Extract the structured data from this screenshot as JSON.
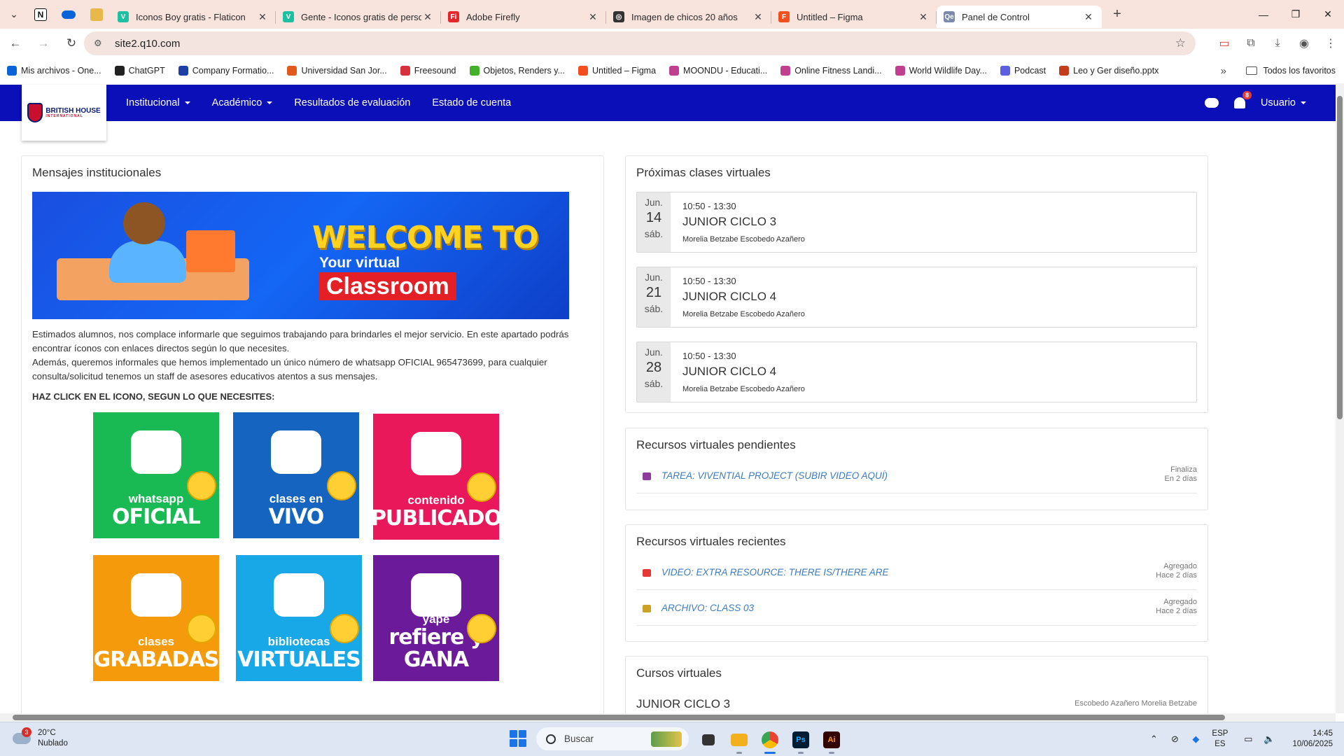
{
  "browser": {
    "tabs": [
      {
        "title": "Iconos Boy gratis - Flaticon",
        "color": "#1ec0a3",
        "glyph": "V"
      },
      {
        "title": "Gente - Iconos gratis de person",
        "color": "#1ec0a3",
        "glyph": "V"
      },
      {
        "title": "Adobe Firefly",
        "color": "#e4262c",
        "glyph": "Fi"
      },
      {
        "title": "Imagen de chicos 20 años",
        "color": "#333333",
        "glyph": "◎"
      },
      {
        "title": "Untitled – Figma",
        "color": "#f24e1e",
        "glyph": "F"
      },
      {
        "title": "Panel de Control",
        "color": "#7a8aa8",
        "glyph": "Qe"
      }
    ],
    "address": "site2.q10.com",
    "bookmarks": [
      {
        "label": "Mis archivos - One...",
        "color": "#0a64d8"
      },
      {
        "label": "ChatGPT",
        "color": "#222222"
      },
      {
        "label": "Company Formatio...",
        "color": "#1f3fa8"
      },
      {
        "label": "Universidad San Jor...",
        "color": "#e05a1d"
      },
      {
        "label": "Freesound",
        "color": "#d9303e"
      },
      {
        "label": "Objetos, Renders y...",
        "color": "#43b02a"
      },
      {
        "label": "Untitled – Figma",
        "color": "#f24e1e"
      },
      {
        "label": "MOONDU - Educati...",
        "color": "#c0408f"
      },
      {
        "label": "Online Fitness Landi...",
        "color": "#c0408f"
      },
      {
        "label": "World Wildlife Day...",
        "color": "#c0408f"
      },
      {
        "label": "Podcast",
        "color": "#5b5fe0"
      },
      {
        "label": "Leo y Ger diseño.pptx",
        "color": "#c43e1c"
      }
    ],
    "favorites_label": "Todos los favoritos"
  },
  "site": {
    "brand": "BRITISH HOUSE",
    "brand_sub": "INTERNATIONAL",
    "menu": [
      {
        "label": "Institucional",
        "dropdown": true
      },
      {
        "label": "Académico",
        "dropdown": true
      },
      {
        "label": "Resultados de evaluación",
        "dropdown": false
      },
      {
        "label": "Estado de cuenta",
        "dropdown": false
      }
    ],
    "notifications": "8",
    "user": "Usuario",
    "accent": "#0a0fb8"
  },
  "messages": {
    "title": "Mensajes institucionales",
    "banner": {
      "line1": "WELCOME TO",
      "line2": "Your virtual",
      "line3": "Classroom"
    },
    "paragraph1": "Estimados alumnos, nos complace informarle que seguimos trabajando para brindarles el mejor servicio. En este apartado podrás encontrar íconos con enlaces directos según lo que necesites.",
    "paragraph2": "Además, queremos informales que hemos implementado un único número de whatsapp OFICIAL 965473699, para cualquier consulta/solicitud tenemos un staff de asesores educativos atentos a sus mensajes.",
    "cta": "HAZ CLICK EN EL ICONO, SEGUN LO QUE NECESITES:",
    "tiles": [
      {
        "small": "whatsapp",
        "big": "OFICIAL",
        "color": "#19b954"
      },
      {
        "small": "clases en",
        "big": "VIVO",
        "color": "#1565c0"
      },
      {
        "small": "contenido",
        "big": "PUBLICADO",
        "color": "#e8185b"
      },
      {
        "small": "clases",
        "big": "GRABADAS",
        "color": "#f59b0b"
      },
      {
        "small": "bibliotecas",
        "big": "VIRTUALES",
        "color": "#18a8e8"
      },
      {
        "small": "yape",
        "big": "refiere y GANA",
        "color": "#6b1a9a"
      }
    ]
  },
  "upcoming": {
    "title": "Próximas clases virtuales",
    "classes": [
      {
        "month": "Jun.",
        "day": "14",
        "weekday": "sáb.",
        "time": "10:50 - 13:30",
        "name": "JUNIOR CICLO 3",
        "teacher": "Morelia Betzabe Escobedo Azañero"
      },
      {
        "month": "Jun.",
        "day": "21",
        "weekday": "sáb.",
        "time": "10:50 - 13:30",
        "name": "JUNIOR CICLO 4",
        "teacher": "Morelia Betzabe Escobedo Azañero"
      },
      {
        "month": "Jun.",
        "day": "28",
        "weekday": "sáb.",
        "time": "10:50 - 13:30",
        "name": "JUNIOR CICLO 4",
        "teacher": "Morelia Betzabe Escobedo Azañero"
      }
    ]
  },
  "pending": {
    "title": "Recursos virtuales pendientes",
    "items": [
      {
        "label": "TAREA: VIVENTIAL PROJECT (SUBIR VIDEO AQUÍ)",
        "meta1": "Finaliza",
        "meta2": "En 2 días",
        "icon": "task-icon",
        "color": "#8e3b9e"
      }
    ]
  },
  "recent": {
    "title": "Recursos virtuales recientes",
    "items": [
      {
        "label": "VIDEO: EXTRA RESOURCE: THERE IS/THERE ARE",
        "meta1": "Agregado",
        "meta2": "Hace 2 días",
        "icon": "video-icon",
        "color": "#e53935"
      },
      {
        "label": "ARCHIVO: CLASS 03",
        "meta1": "Agregado",
        "meta2": "Hace 2 días",
        "icon": "paperclip-icon",
        "color": "#c9a227"
      }
    ]
  },
  "courses": {
    "title": "Cursos virtuales",
    "items": [
      {
        "name": "JUNIOR CICLO 3",
        "teacher": "Escobedo Azañero Morelia Betzabe"
      }
    ]
  },
  "taskbar": {
    "weather_badge": "3",
    "temperature": "20°C",
    "condition": "Nublado",
    "search_placeholder": "Buscar",
    "lang1": "ESP",
    "lang2": "ES",
    "time": "14:45",
    "date": "10/06/2025"
  }
}
